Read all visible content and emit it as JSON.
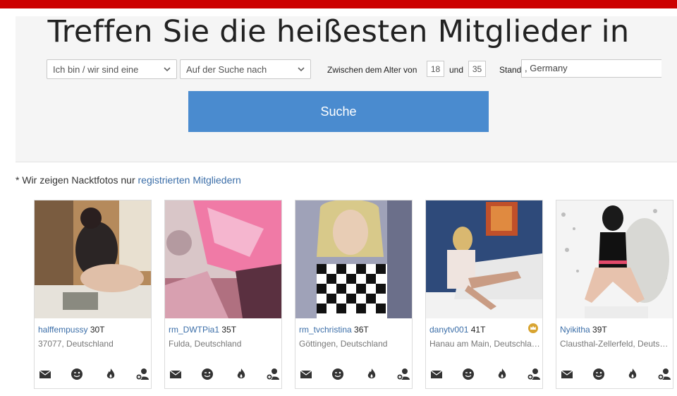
{
  "colors": {
    "topbar": "#cc0000",
    "button": "#4a8bcf",
    "link": "#3b6ea8"
  },
  "headline": "Treffen Sie die heißesten Mitglieder in",
  "filters": {
    "gender_select": "Ich bin / wir sind eine",
    "seeking_select": "Auf der Suche nach",
    "age_label": "Zwischen dem Alter von",
    "age_min": "18",
    "age_and": "und",
    "age_max": "35",
    "location_label": "Standort",
    "location_value": ", Germany"
  },
  "search_button": "Suche",
  "notice": {
    "text": "* Wir zeigen Nacktfotos nur ",
    "link": "registrierten Mitgliedern"
  },
  "members": [
    {
      "username": "halffempussy",
      "age": "30T",
      "location": "37077, Deutschland",
      "crown": false
    },
    {
      "username": "rm_DWTPia1",
      "age": "35T",
      "location": "Fulda, Deutschland",
      "crown": false
    },
    {
      "username": "rm_tvchristina",
      "age": "36T",
      "location": "Göttingen, Deutschland",
      "crown": false
    },
    {
      "username": "danytv001",
      "age": "41T",
      "location": "Hanau am Main, Deutschland",
      "crown": true
    },
    {
      "username": "Nyikitha",
      "age": "39T",
      "location": "Clausthal-Zellerfeld, Deutschland",
      "crown": false
    }
  ]
}
